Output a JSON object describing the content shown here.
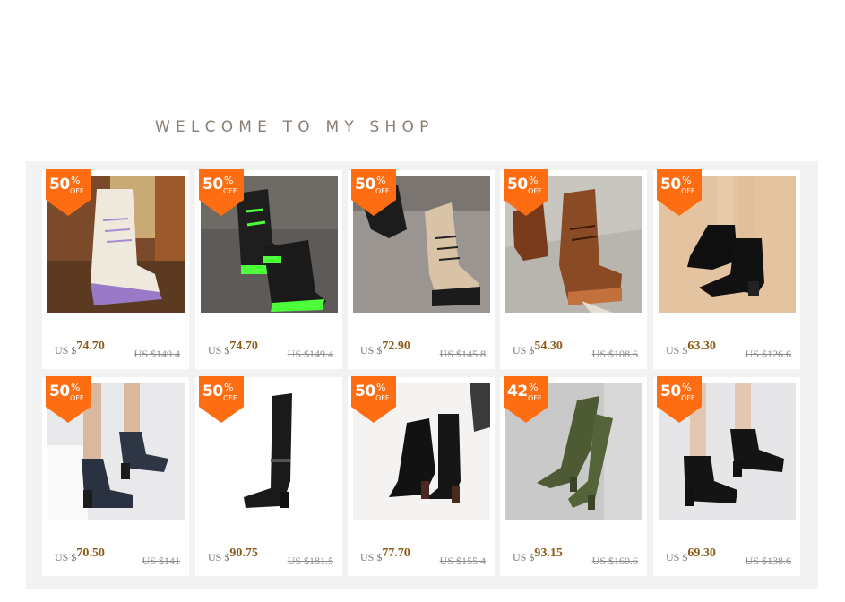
{
  "shop": {
    "welcome_text": "WELCOME TO MY SHOP"
  },
  "colors": {
    "badge": "#ff6d12",
    "price": "#8b5a14",
    "panel": "#f2f2f2"
  },
  "products": [
    {
      "discount": "50",
      "pct": "%",
      "off": "OFF",
      "currency": "US $",
      "price": "74.70",
      "original": "US $149.4"
    },
    {
      "discount": "50",
      "pct": "%",
      "off": "OFF",
      "currency": "US $",
      "price": "74.70",
      "original": "US $149.4"
    },
    {
      "discount": "50",
      "pct": "%",
      "off": "OFF",
      "currency": "US $",
      "price": "72.90",
      "original": "US $145.8"
    },
    {
      "discount": "50",
      "pct": "%",
      "off": "OFF",
      "currency": "US $",
      "price": "54.30",
      "original": "US $108.6"
    },
    {
      "discount": "50",
      "pct": "%",
      "off": "OFF",
      "currency": "US $",
      "price": "63.30",
      "original": "US $126.6"
    },
    {
      "discount": "50",
      "pct": "%",
      "off": "OFF",
      "currency": "US $",
      "price": "70.50",
      "original": "US $141"
    },
    {
      "discount": "50",
      "pct": "%",
      "off": "OFF",
      "currency": "US $",
      "price": "90.75",
      "original": "US $181.5"
    },
    {
      "discount": "50",
      "pct": "%",
      "off": "OFF",
      "currency": "US $",
      "price": "77.70",
      "original": "US $155.4"
    },
    {
      "discount": "42",
      "pct": "%",
      "off": "OFF",
      "currency": "US $",
      "price": "93.15",
      "original": "US $160.6"
    },
    {
      "discount": "50",
      "pct": "%",
      "off": "OFF",
      "currency": "US $",
      "price": "69.30",
      "original": "US $138.6"
    }
  ]
}
